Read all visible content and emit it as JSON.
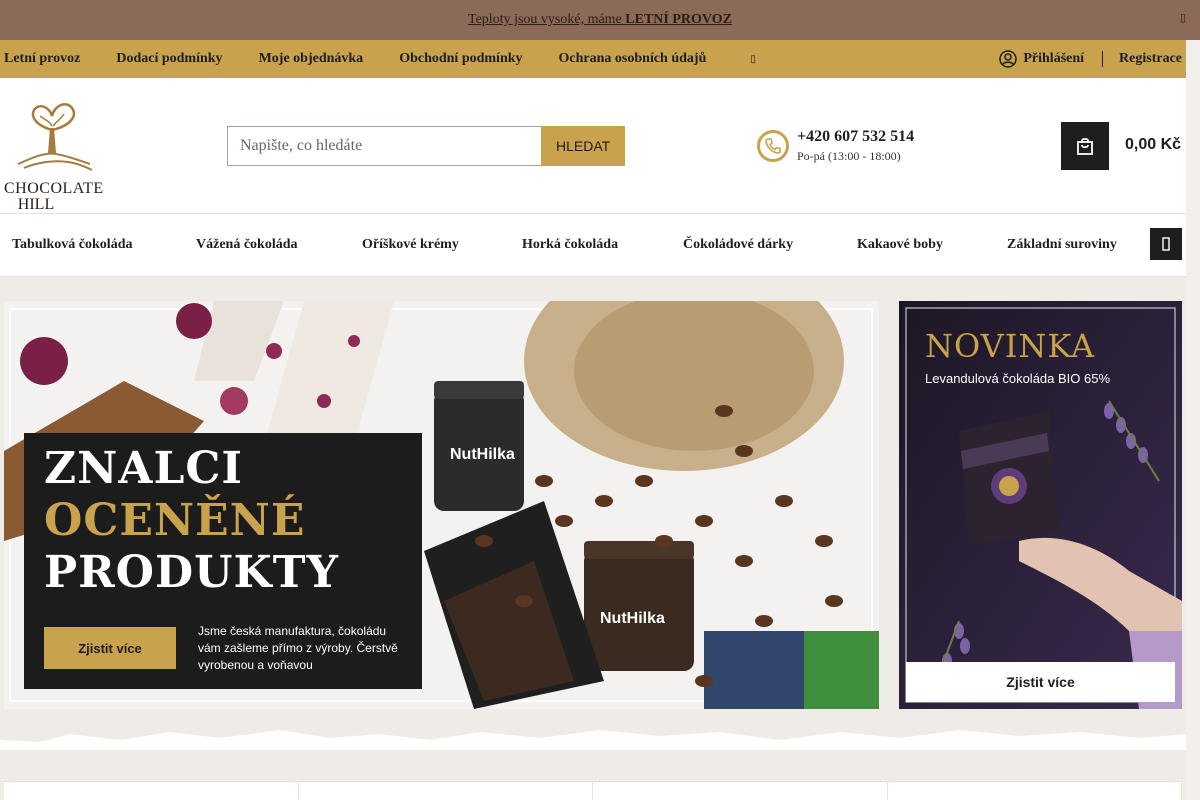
{
  "announcement": {
    "text": "Teploty jsou vysoké, máme ",
    "highlight": "LETNÍ PROVOZ",
    "close_icon": "close-icon"
  },
  "subnav": {
    "items": [
      "Letní provoz",
      "Dodací podmínky",
      "Moje objednávka",
      "Obchodní podmínky",
      "Ochrana osobních údajů"
    ],
    "more_icon": "chevron-right-icon",
    "login": "Přihlášení",
    "register": "Registrace"
  },
  "header": {
    "logo_line1": "CHOCOLATE",
    "logo_line2": "HILL",
    "search_placeholder": "Napište, co hledáte",
    "search_button": "HLEDAT",
    "phone_number": "+420 607 532 514",
    "phone_hours": "Po-pá (13:00 - 18:00)",
    "cart_price": "0,00 Kč"
  },
  "categories": [
    "Tabulková čokoláda",
    "Vážená čokoláda",
    "Oříškové krémy",
    "Horká čokoláda",
    "Čokoládové dárky",
    "Kakaové boby",
    "Základní suroviny"
  ],
  "hero": {
    "line1": "ZNALCI",
    "line2": "OCENĚNÉ",
    "line3": "PRODUKTY",
    "button": "Zjistit více",
    "description": "Jsme česká manufaktura, čokoládu vám zašleme přímo z výroby. Čerstvě vyrobenou a voňavou",
    "jar_label": "NutHilka"
  },
  "side_banner": {
    "title": "NOVINKA",
    "subtitle": "Levandulová čokoláda BIO 65%",
    "button": "Zjistit více"
  },
  "colors": {
    "brand_gold": "#c9a24e",
    "banner_brown": "#8b6a57",
    "dark": "#1e1e1e",
    "side_bg": "#1f1a29"
  }
}
